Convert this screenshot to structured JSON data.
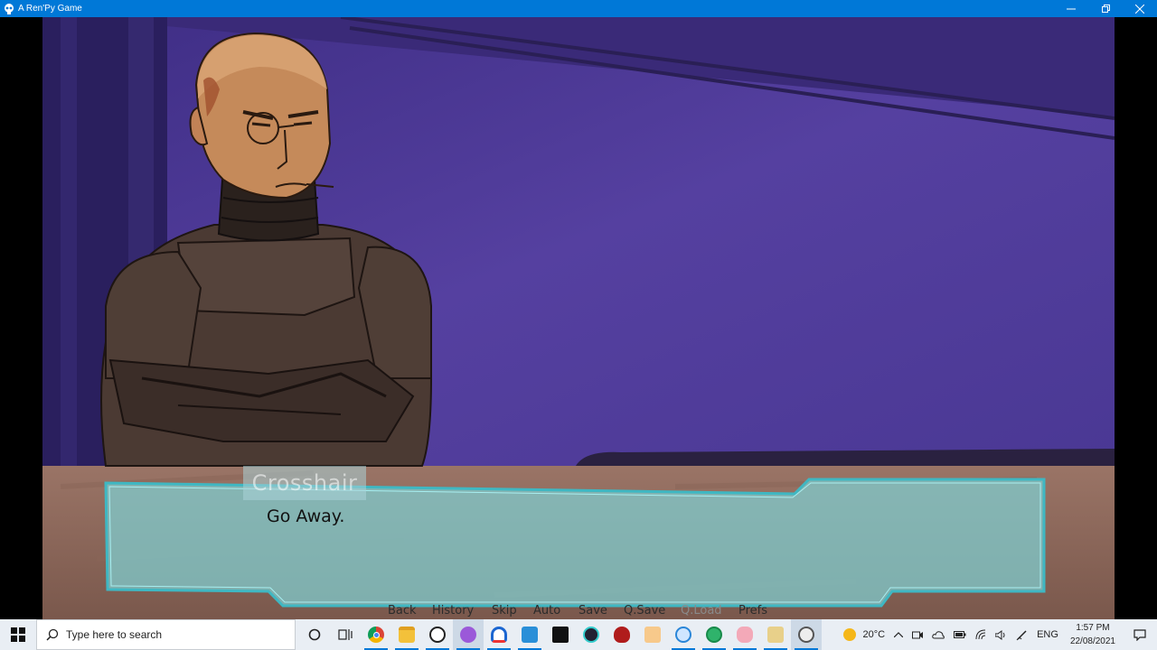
{
  "window": {
    "title": "A Ren'Py Game",
    "icon": "skull-icon",
    "controls": [
      "minimize-icon",
      "maximize-icon",
      "close-icon"
    ]
  },
  "dialogue": {
    "speaker": "Crosshair",
    "text": "Go Away."
  },
  "quick_menu": [
    {
      "label": "Back",
      "enabled": true
    },
    {
      "label": "History",
      "enabled": true
    },
    {
      "label": "Skip",
      "enabled": true
    },
    {
      "label": "Auto",
      "enabled": true
    },
    {
      "label": "Save",
      "enabled": true
    },
    {
      "label": "Q.Save",
      "enabled": true
    },
    {
      "label": "Q.Load",
      "enabled": false
    },
    {
      "label": "Prefs",
      "enabled": true
    }
  ],
  "taskbar": {
    "search_placeholder": "Type here to search",
    "apps": [
      "chrome-icon",
      "file-explorer-icon",
      "steam-icon",
      "app-icon",
      "headphones-icon",
      "app-icon",
      "app-icon",
      "app-icon",
      "app-icon",
      "app-icon",
      "app-icon",
      "globe-icon",
      "app-icon",
      "app-icon",
      "skull-icon"
    ],
    "weather_temp": "20°C",
    "language": "ENG",
    "time": "1:57 PM",
    "date": "22/08/2021"
  },
  "colors": {
    "titlebar": "#0078d7",
    "scene_wall": "#553f9c",
    "dialogue_box": "#7fd0d3",
    "dialogue_border": "#3fb7c2",
    "taskbar": "#e9eef4"
  }
}
